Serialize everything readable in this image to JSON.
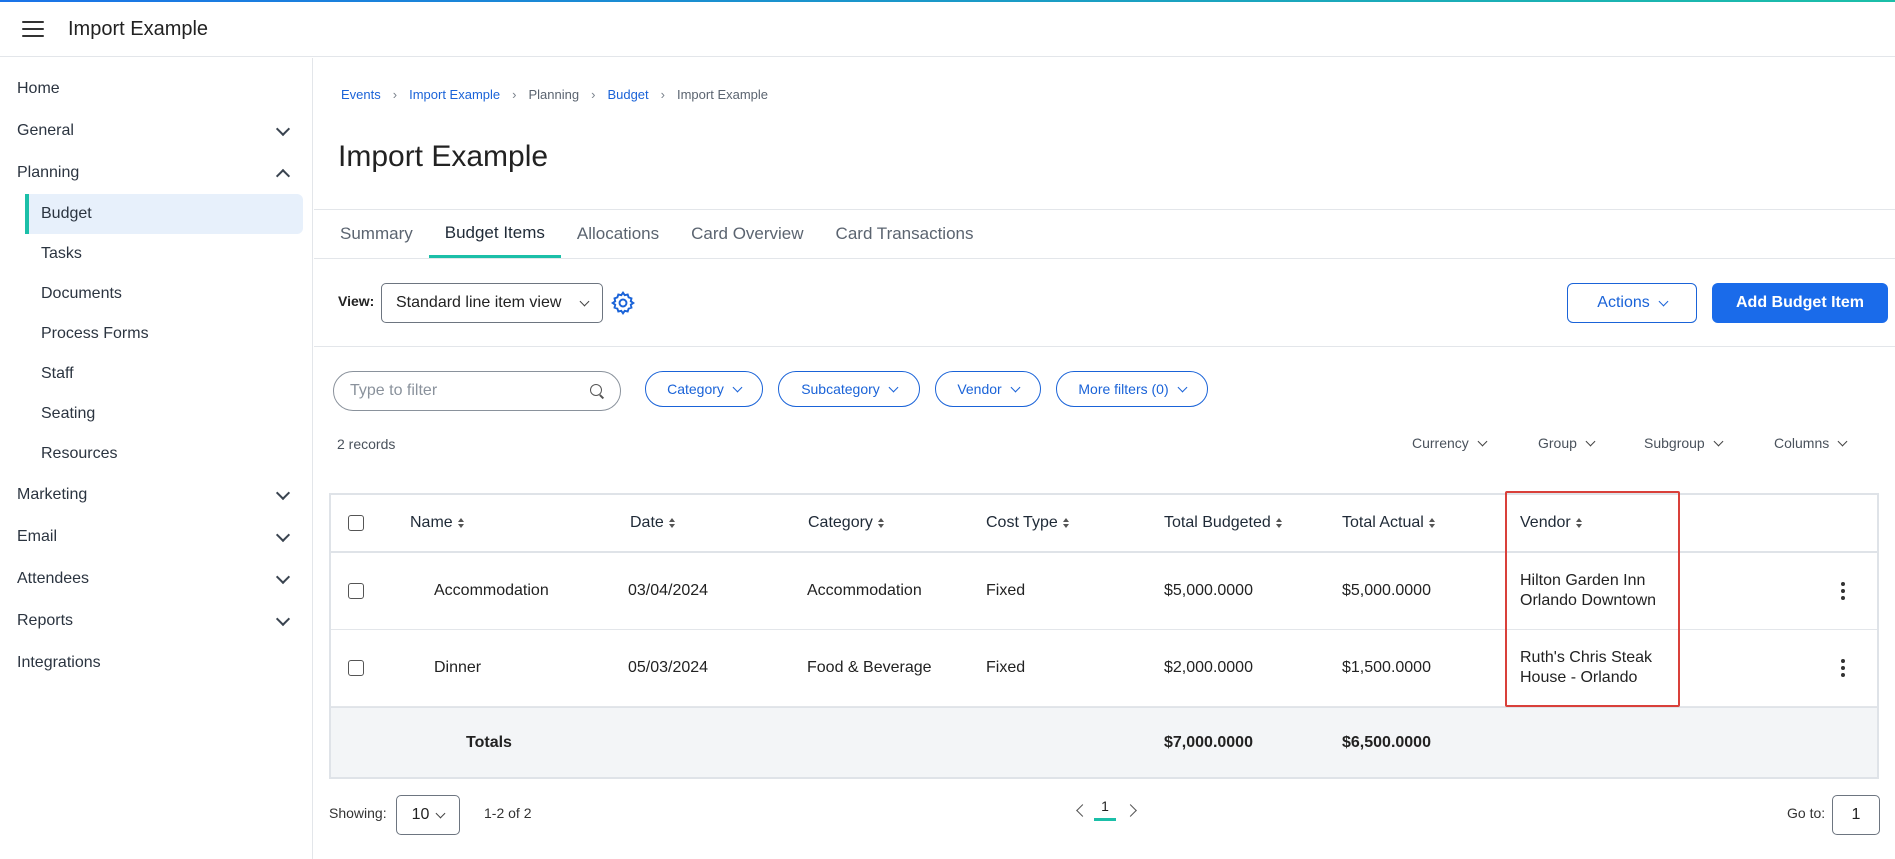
{
  "app": {
    "title": "Import Example"
  },
  "sidebar": {
    "items": [
      {
        "label": "Home"
      },
      {
        "label": "General"
      },
      {
        "label": "Planning"
      },
      {
        "label": "Marketing"
      },
      {
        "label": "Email"
      },
      {
        "label": "Attendees"
      },
      {
        "label": "Reports"
      },
      {
        "label": "Integrations"
      }
    ],
    "planning_sub": [
      {
        "label": "Budget"
      },
      {
        "label": "Tasks"
      },
      {
        "label": "Documents"
      },
      {
        "label": "Process Forms"
      },
      {
        "label": "Staff"
      },
      {
        "label": "Seating"
      },
      {
        "label": "Resources"
      }
    ]
  },
  "breadcrumb": [
    "Events",
    "Import Example",
    "Planning",
    "Budget",
    "Import Example"
  ],
  "page_title": "Import Example",
  "tabs": [
    "Summary",
    "Budget Items",
    "Allocations",
    "Card Overview",
    "Card Transactions"
  ],
  "toolbar": {
    "view_label": "View:",
    "view_value": "Standard line item view",
    "actions_label": "Actions",
    "add_label": "Add Budget Item"
  },
  "filters": {
    "placeholder": "Type to filter",
    "pills": [
      "Category",
      "Subcategory",
      "Vendor",
      "More filters (0)"
    ]
  },
  "records_label": "2 records",
  "options": [
    "Currency",
    "Group",
    "Subgroup",
    "Columns"
  ],
  "table": {
    "columns": [
      "Name",
      "Date",
      "Category",
      "Cost Type",
      "Total Budgeted",
      "Total Actual",
      "Vendor"
    ],
    "rows": [
      {
        "name": "Accommodation",
        "date": "03/04/2024",
        "category": "Accommodation",
        "cost_type": "Fixed",
        "budgeted": "$5,000.0000",
        "actual": "$5,000.0000",
        "vendor_1": "Hilton Garden Inn",
        "vendor_2": "Orlando Downtown"
      },
      {
        "name": "Dinner",
        "date": "05/03/2024",
        "category": "Food & Beverage",
        "cost_type": "Fixed",
        "budgeted": "$2,000.0000",
        "actual": "$1,500.0000",
        "vendor_1": "Ruth's Chris Steak",
        "vendor_2": "House - Orlando"
      }
    ],
    "totals": {
      "label": "Totals",
      "budgeted": "$7,000.0000",
      "actual": "$6,500.0000"
    }
  },
  "pager": {
    "showing_label": "Showing:",
    "page_size": "10",
    "range": "1-2 of 2",
    "page": "1",
    "goto_label": "Go to:",
    "goto_value": "1"
  },
  "colors": {
    "accent": "#1bbfa8",
    "primary": "#1a6bea",
    "highlight": "#d9403a"
  }
}
